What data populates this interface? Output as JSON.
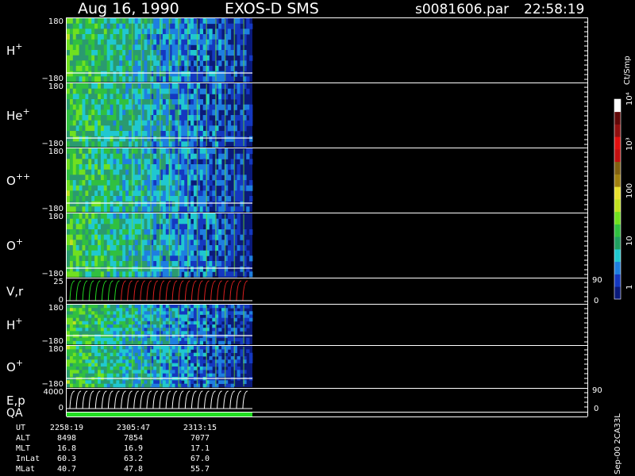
{
  "header": {
    "date": "Aug 16, 1990",
    "instrument": "EXOS-D SMS",
    "file": "s0081606.par",
    "time": "22:58:19"
  },
  "colors": {
    "background": "#000000",
    "spectrogram_fill": "#0a1a7a",
    "line": "#ffffff",
    "red_trace": "#e02020",
    "green_bar": "#22dd22"
  },
  "chart_data": {
    "type": "heatmap",
    "panels": [
      {
        "label": "H",
        "sup": "+",
        "ymax": "180",
        "ymin": "−180",
        "kind": "spectrogram"
      },
      {
        "label": "He",
        "sup": "+",
        "ymax": "180",
        "ymin": "−180",
        "kind": "spectrogram"
      },
      {
        "label": "O",
        "sup": "++",
        "ymax": "180",
        "ymin": "−180",
        "kind": "spectrogram"
      },
      {
        "label": "O",
        "sup": "+",
        "ymax": "180",
        "ymin": "−180",
        "kind": "spectrogram"
      },
      {
        "label": "V,r",
        "sup": "",
        "ymax": "25",
        "ymin": "0",
        "kind": "lines",
        "right_top": "90",
        "right_bottom": "0"
      },
      {
        "label": "H",
        "sup": "+",
        "ymax": "180",
        "ymin": "−180",
        "kind": "spectrogram"
      },
      {
        "label": "O",
        "sup": "+",
        "ymax": "180",
        "ymin": "−180",
        "kind": "spectrogram"
      },
      {
        "label": "E,p",
        "sup": "",
        "ymax": "4000",
        "ymin": "0",
        "kind": "lines",
        "right_top": "90",
        "right_bottom": "0"
      }
    ],
    "qa_label": "QA",
    "colorbar": {
      "unit": "Ct/Smp",
      "ticks": [
        "1",
        "10",
        "100",
        "10³",
        "10⁴"
      ],
      "colors": [
        "#0a1a7a",
        "#1438c0",
        "#1e7fe0",
        "#20c8d0",
        "#20a060",
        "#30c040",
        "#70e020",
        "#c0e020",
        "#e8e030",
        "#a08010",
        "#806010",
        "#c01010",
        "#e01010",
        "#901010",
        "#600808",
        "#ffffff"
      ]
    },
    "orbit": {
      "row_labels": [
        "UT",
        "ALT",
        "MLT",
        "InLat",
        "MLat"
      ],
      "columns": [
        [
          "2258:19",
          "8498",
          "16.8",
          "60.3",
          "40.7"
        ],
        [
          "2305:47",
          "7854",
          "16.9",
          "63.2",
          "47.8"
        ],
        [
          "2313:15",
          "7077",
          "17.1",
          "67.0",
          "55.7"
        ]
      ]
    },
    "footer_id": "Sep-00 2CA33L"
  }
}
